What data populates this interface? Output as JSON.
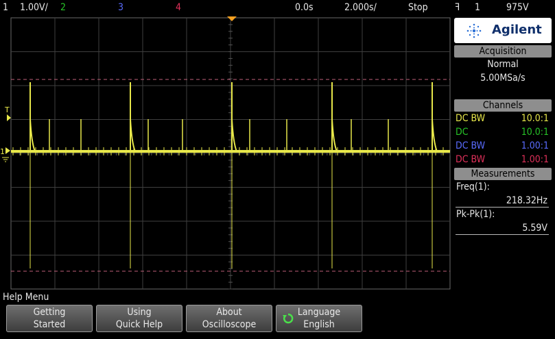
{
  "topbar": {
    "ch1_label": "1",
    "ch1_scale": "1.00V/",
    "ch2_label": "2",
    "ch3_label": "3",
    "ch4_label": "4",
    "time_position": "0.0s",
    "time_scale": "2.000s/",
    "run_state": "Stop",
    "trigger_icon": "ꟻ",
    "trigger_channel": "1",
    "trigger_level": "975V"
  },
  "markers": {
    "trigger_marker": "T",
    "ch1_ground_marker": "1"
  },
  "panel": {
    "brand": "Agilent",
    "acquisition": {
      "title": "Acquisition",
      "mode": "Normal",
      "rate": "5.00MSa/s"
    },
    "channels": {
      "title": "Channels",
      "rows": [
        {
          "coupling": "DC BW",
          "probe": "10.0:1",
          "color": "#e8e84a"
        },
        {
          "coupling": "DC",
          "probe": "10.0:1",
          "color": "#27c427"
        },
        {
          "coupling": "DC BW",
          "probe": "1.00:1",
          "color": "#5a6cff"
        },
        {
          "coupling": "DC BW",
          "probe": "1.00:1",
          "color": "#e0305a"
        }
      ]
    },
    "measurements": {
      "title": "Measurements",
      "items": [
        {
          "label": "Freq(1):",
          "value": "218.32Hz"
        },
        {
          "label": "Pk-Pk(1):",
          "value": "5.59V"
        }
      ]
    }
  },
  "help": {
    "menu_title": "Help Menu",
    "softkeys": [
      {
        "line1": "Getting",
        "line2": "Started"
      },
      {
        "line1": "Using",
        "line2": "Quick Help"
      },
      {
        "line1": "About",
        "line2": "Oscilloscope"
      },
      {
        "line1": "Language",
        "line2": "English"
      }
    ]
  },
  "colors": {
    "trace": "#e8e84a",
    "grid": "#4a4a4a",
    "limit_lines": "#c0607a",
    "trigger_marker": "#f5a020"
  }
}
